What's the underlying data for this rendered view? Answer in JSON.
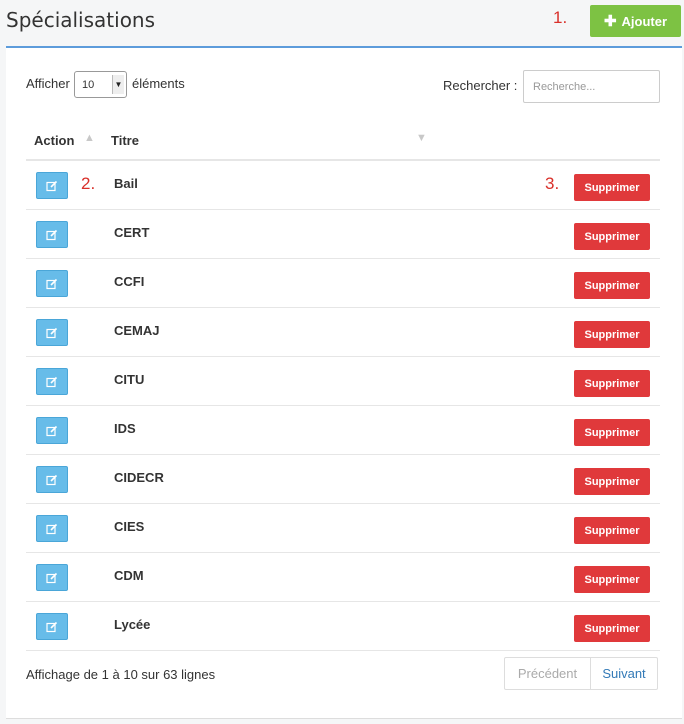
{
  "header": {
    "title": "Spécialisations",
    "add_label": "Ajouter",
    "add_icon": "plus-icon",
    "accent_color": "#7dc243"
  },
  "annotations": [
    "1.",
    "2.",
    "3."
  ],
  "controls": {
    "show_label": "Afficher",
    "page_length": "10",
    "elements_label": "éléments",
    "search_label": "Rechercher :",
    "search_placeholder": "Recherche..."
  },
  "table": {
    "columns": [
      "Action",
      "Titre"
    ],
    "edit_icon": "edit-icon",
    "delete_label": "Supprimer",
    "delete_color": "#e0393b",
    "edit_color": "#67bce9",
    "rows": [
      {
        "title": "Bail"
      },
      {
        "title": "CERT"
      },
      {
        "title": "CCFI"
      },
      {
        "title": "CEMAJ"
      },
      {
        "title": "CITU"
      },
      {
        "title": "IDS"
      },
      {
        "title": "CIDECR"
      },
      {
        "title": "CIES"
      },
      {
        "title": "CDM"
      },
      {
        "title": "Lycée"
      }
    ]
  },
  "footer": {
    "info": "Affichage de 1 à 10 sur 63 lignes",
    "prev_label": "Précédent",
    "next_label": "Suivant"
  }
}
